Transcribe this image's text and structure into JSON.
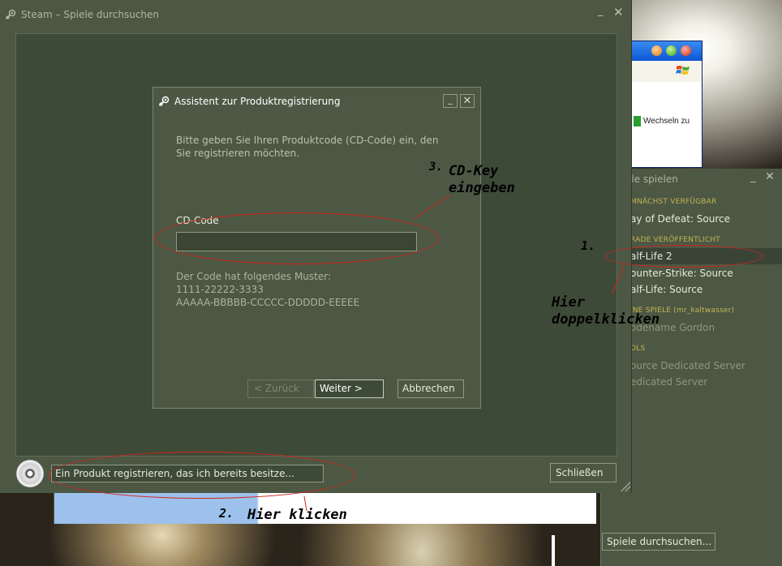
{
  "xp_window": {
    "wechseln_label": "Wechseln zu"
  },
  "games_panel": {
    "title": "ele spielen",
    "min_icon": "minimize-icon",
    "close_icon": "close-icon",
    "categories": [
      {
        "label": "MNÄCHST VERFÜGBAR",
        "items": [
          {
            "label": "ay of Defeat: Source",
            "dim": false
          }
        ]
      },
      {
        "label": "RADE VERÖFFENTLICHT",
        "items": [
          {
            "label": "alf-Life 2",
            "dim": false,
            "selected": true
          },
          {
            "label": "ounter-Strike: Source",
            "dim": false
          },
          {
            "label": "alf-Life: Source",
            "dim": false
          }
        ]
      },
      {
        "label": "INE SPIELE (mr_kaltwasser)",
        "items": [
          {
            "label": "odename Gordon",
            "dim": true
          }
        ]
      },
      {
        "label": "OLS",
        "items": [
          {
            "label": "ource Dedicated Server",
            "dim": true
          },
          {
            "label": "edicated Server",
            "dim": true
          }
        ]
      }
    ],
    "browse_button": "Spiele durchsuchen..."
  },
  "main_window": {
    "title": "Steam – Spiele durchsuchen",
    "min_label": "_",
    "close_label": "✕",
    "register_link": "Ein Produkt registrieren, das ich bereits besitze...",
    "close_button": "Schließen"
  },
  "dialog": {
    "title": "Assistent zur Produktregistrierung",
    "min_label": "_",
    "close_label": "✕",
    "prompt": "Bitte geben Sie Ihren Produktcode (CD-Code) ein, den Sie registrieren möchten.",
    "cd_label": "CD-Code",
    "cd_value": "",
    "pattern_heading": "Der Code hat folgendes Muster:",
    "pattern_1": "1111-22222-3333",
    "pattern_2": "AAAAA-BBBBB-CCCCC-DDDDD-EEEEE",
    "back_button": "< Zurück",
    "next_button": "Weiter >",
    "cancel_button": "Abbrechen"
  },
  "annotations": {
    "step1_number": "1.",
    "step1_line1": "Hier",
    "step1_line2": "doppelklicken",
    "step2_number": "2.",
    "step2_text": "Hier klicken",
    "step3_number": "3.",
    "step3_line1": "CD-Key",
    "step3_line2": "eingeben",
    "annotation_color": "#d2231a"
  },
  "colors": {
    "steam_bg": "#4c5844",
    "steam_content": "#3e4a38",
    "category_yellow": "#c6b44f"
  }
}
